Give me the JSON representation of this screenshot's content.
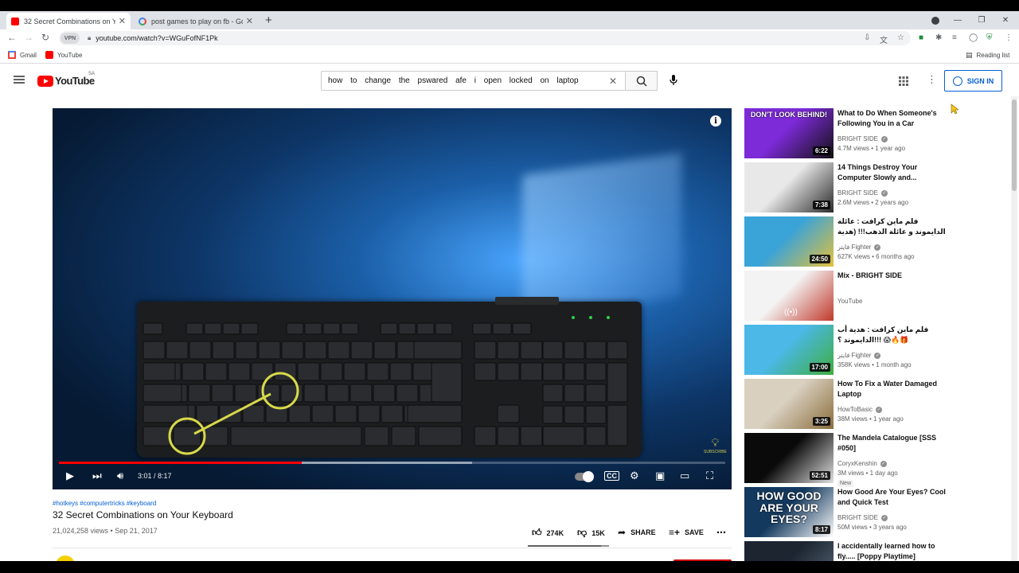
{
  "browser": {
    "tabs": [
      {
        "title": "32 Secret Combinations on Your",
        "active": true
      },
      {
        "title": "post games to play on fb - Goog",
        "active": false
      }
    ],
    "url": "youtube.com/watch?v=WGuFofNF1Pk",
    "vpn_label": "VPN",
    "bookmarks": [
      {
        "label": "Gmail"
      },
      {
        "label": "YouTube"
      }
    ],
    "reading_list_label": "Reading list"
  },
  "youtube": {
    "logo_text": "YouTube",
    "country_code": "SA",
    "search_query": "how to change the pswared afe i open locked on laptop",
    "signin_label": "SIGN IN"
  },
  "video": {
    "current_time": "3:01",
    "duration": "8:17",
    "time_display": "3:01 / 8:17",
    "played_fraction": 0.364,
    "buffered_fraction": 0.62,
    "hashtags": "#hotkeys #computertricks #keyboard",
    "title": "32 Secret Combinations on Your Keyboard",
    "views_date": "21,024,258 views • Sep 21, 2017",
    "likes": "274K",
    "dislikes": "15K",
    "share_label": "SHARE",
    "save_label": "SAVE",
    "watermark_text": "SUBSCRIBE"
  },
  "recommendations": [
    {
      "title": "What to Do When Someone's Following You in a Car",
      "channel": "BRIGHT SIDE",
      "verified": true,
      "meta": "4.7M views • 1 year ago",
      "duration": "6:22",
      "thumb_colors": [
        "#7d2ad8",
        "#111111"
      ],
      "thumb_caption": "DON'T LOOK BEHIND!"
    },
    {
      "title": "14 Things Destroy Your Computer Slowly and...",
      "channel": "BRIGHT SIDE",
      "verified": true,
      "meta": "2.6M views • 2 years ago",
      "duration": "7:38",
      "thumb_colors": [
        "#e8e8e8",
        "#2a2a2a"
      ]
    },
    {
      "title": "فلم ماين كرافت : عائلة الدايموند و عائلة الذهب!!! (هدية ولد العم زعلان) 😱🔥",
      "channel": "فايتر Fighter",
      "verified": true,
      "meta": "627K views • 6 months ago",
      "duration": "24:50",
      "thumb_colors": [
        "#3aa3d8",
        "#e5c13a"
      ]
    },
    {
      "title": "Mix - BRIGHT SIDE",
      "channel": "YouTube",
      "verified": false,
      "meta": "",
      "duration": "",
      "thumb_colors": [
        "#f3f3f3",
        "#c0392b"
      ]
    },
    {
      "title": "فلم ماين كرافت : هدية أب الدايموند ؟!!! 😱🔥🎁",
      "channel": "فايتر Fighter",
      "verified": true,
      "meta": "358K views • 1 month ago",
      "duration": "17:00",
      "thumb_colors": [
        "#4bb8e8",
        "#3fae3f"
      ]
    },
    {
      "title": "How To Fix a Water Damaged Laptop",
      "channel": "HowToBasic",
      "verified": true,
      "meta": "38M views • 1 year ago",
      "duration": "3:25",
      "thumb_colors": [
        "#d9d0c0",
        "#8a6d3b"
      ]
    },
    {
      "title": "The Mandela Catalogue [SSS #050]",
      "channel": "CoryxKenshin",
      "verified": true,
      "meta": "3M views • 1 day ago",
      "duration": "52:51",
      "badge": "New",
      "thumb_colors": [
        "#0a0a0a",
        "#e0e0e0"
      ]
    },
    {
      "title": "How Good Are Your Eyes? Cool and Quick Test",
      "channel": "BRIGHT SIDE",
      "verified": true,
      "meta": "50M views • 3 years ago",
      "duration": "8:17",
      "thumb_colors": [
        "#13395e",
        "#ffffff"
      ],
      "thumb_caption": "HOW GOOD ARE YOUR EYES?"
    },
    {
      "title": "I accidentally learned how to fly..... [Poppy Playtime]",
      "channel": "",
      "verified": false,
      "meta": "",
      "duration": "",
      "thumb_colors": [
        "#1c2530",
        "#5b6b7b"
      ]
    }
  ]
}
